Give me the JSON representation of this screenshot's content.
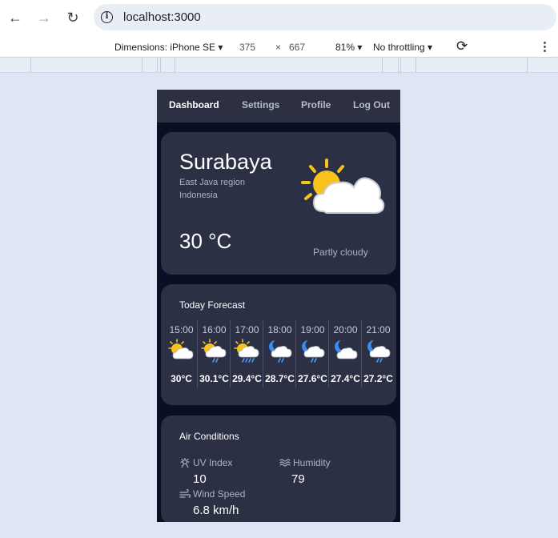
{
  "browser": {
    "url": "localhost:3000",
    "back_icon": "←",
    "forward_icon": "→",
    "reload_icon": "↻",
    "info_icon": "i"
  },
  "devtools": {
    "dimensions": "Dimensions: iPhone SE ▾",
    "width": "375",
    "times": "×",
    "height": "667",
    "zoom": "81% ▾",
    "throttling": "No throttling ▾",
    "rotate_icon": "⟳",
    "menu_icon": "⋮"
  },
  "nav": {
    "items": [
      {
        "label": "Dashboard",
        "active": true
      },
      {
        "label": "Settings"
      },
      {
        "label": "Profile"
      },
      {
        "label": "Log Out"
      }
    ]
  },
  "current": {
    "city": "Surabaya",
    "region": "East Java region",
    "country": "Indonesia",
    "temperature": "30 °C",
    "condition": "Partly cloudy",
    "icon": "partly-cloudy-icon"
  },
  "forecast": {
    "title": "Today Forecast",
    "hours": [
      {
        "time": "15:00",
        "temp": "30°C",
        "icon": "sun-cloud-icon"
      },
      {
        "time": "16:00",
        "temp": "30.1°C",
        "icon": "sun-cloud-rain-icon"
      },
      {
        "time": "17:00",
        "temp": "29.4°C",
        "icon": "sun-cloud-rain-icon"
      },
      {
        "time": "18:00",
        "temp": "28.7°C",
        "icon": "moon-cloud-rain-icon"
      },
      {
        "time": "19:00",
        "temp": "27.6°C",
        "icon": "moon-cloud-rain-icon"
      },
      {
        "time": "20:00",
        "temp": "27.4°C",
        "icon": "moon-cloud-icon"
      },
      {
        "time": "21:00",
        "temp": "27.2°C",
        "icon": "moon-cloud-rain-icon"
      }
    ]
  },
  "air": {
    "title": "Air Conditions",
    "uv_label": "UV Index",
    "uv_value": "10",
    "humidity_label": "Humidity",
    "humidity_value": "79",
    "wind_label": "Wind Speed",
    "wind_value": "6.8 km/h"
  },
  "colors": {
    "page_bg": "#dfe6f3",
    "device_bg": "#0a0f25",
    "card_bg": "#2c3045",
    "nav_bg": "#2c3042",
    "sun": "#f8c21c",
    "moon": "#3a8ff0",
    "rain": "#4d9cf7"
  }
}
